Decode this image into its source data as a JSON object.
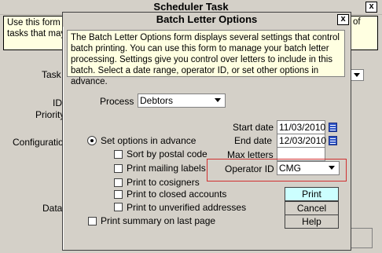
{
  "parent": {
    "title": "Scheduler Task",
    "close_glyph": "x",
    "desc_left_line1": "Use this form to",
    "desc_left_line2": "tasks that may",
    "desc_right": "of",
    "labels": {
      "task": "Task",
      "id": "ID",
      "priority": "Priority",
      "configuration": "Configuration",
      "data": "Data"
    }
  },
  "dialog": {
    "title": "Batch Letter Options",
    "close_glyph": "x",
    "description": "The Batch Letter Options form displays several settings that control batch printing. You can use this form to manage your batch letter processing. Settings give you control over letters to include in this batch. Select a date range, operator ID, or set other options in advance.",
    "process": {
      "label": "Process",
      "value": "Debtors"
    },
    "set_options_label": "Set options in advance",
    "start_date": {
      "label": "Start date",
      "value": "11/03/2010"
    },
    "end_date": {
      "label": "End date",
      "value": "12/03/2010"
    },
    "max_letters": {
      "label": "Max letters",
      "value": ""
    },
    "operator_id": {
      "label": "Operator ID",
      "value": "CMG"
    },
    "options": [
      {
        "label": "Sort by postal code",
        "checked": false
      },
      {
        "label": "Print mailing labels",
        "checked": false
      },
      {
        "label": "Print to cosigners",
        "checked": false
      },
      {
        "label": "Print to closed accounts",
        "checked": false
      },
      {
        "label": "Print to unverified addresses",
        "checked": false
      }
    ],
    "print_summary_label": "Print summary on last page",
    "buttons": {
      "print": "Print",
      "cancel": "Cancel",
      "help": "Help"
    },
    "colors": {
      "tooltip_bg": "#ffffe1",
      "default_button_bg": "#ccffff",
      "highlight": "#d03030"
    }
  }
}
